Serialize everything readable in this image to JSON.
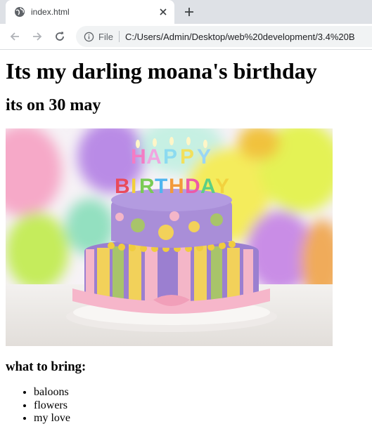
{
  "browser": {
    "tab_title": "index.html",
    "address_scheme_label": "File",
    "url": "C:/Users/Admin/Desktop/web%20development/3.4%20B"
  },
  "page": {
    "heading": "Its my darling moana's birthday",
    "subheading": "its on 30 may",
    "image_candles_text": "HAPPY BIRTHDAY",
    "list_heading": "what to bring:",
    "list_items": [
      "baloons",
      "flowers",
      "my love"
    ]
  },
  "colors": {
    "tabbar_bg": "#dee1e6",
    "omnibox_bg": "#f1f3f4",
    "cake_purple": "#9b7fd0",
    "cake_pink": "#f4b6c8",
    "cake_yellow": "#f2d15a",
    "cake_green": "#a8c46a"
  },
  "icons": {
    "favicon": "globe-icon",
    "tab_close": "close-icon",
    "new_tab": "plus-icon",
    "back": "arrow-left-icon",
    "forward": "arrow-right-icon",
    "reload": "reload-icon",
    "site_info": "info-icon"
  }
}
